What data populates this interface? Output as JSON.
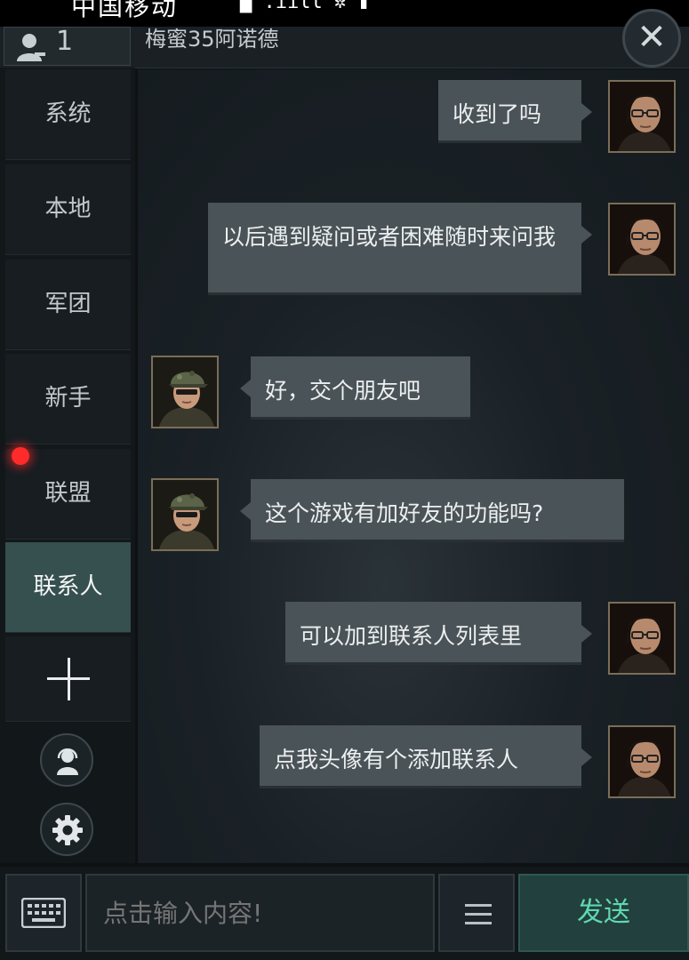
{
  "status_bar": {
    "carrier": "中国移动",
    "signal_text": "▆ .ııll ✲ ▮"
  },
  "header": {
    "online_count": "1",
    "chat_title": "梅蜜35阿诺德",
    "close_icon": "close-icon"
  },
  "sidebar": {
    "tabs": [
      {
        "label": "系统",
        "active": false
      },
      {
        "label": "本地",
        "active": false
      },
      {
        "label": "军团",
        "active": false
      },
      {
        "label": "新手",
        "active": false
      },
      {
        "label": "联盟",
        "active": false,
        "notification": true
      },
      {
        "label": "联系人",
        "active": true
      }
    ],
    "add_icon": "plus-icon",
    "voice_icon": "headset-icon",
    "settings_icon": "gear-icon"
  },
  "messages": [
    {
      "side": "right",
      "text": "收到了吗"
    },
    {
      "side": "right",
      "text": "以后遇到疑问或者困难随时来问我"
    },
    {
      "side": "left",
      "text": "好，交个朋友吧"
    },
    {
      "side": "left",
      "text": "这个游戏有加好友的功能吗?"
    },
    {
      "side": "right",
      "text": "可以加到联系人列表里"
    },
    {
      "side": "right",
      "text": "点我头像有个添加联系人"
    }
  ],
  "input": {
    "placeholder": "点击输入内容!",
    "keyboard_icon": "keyboard-icon",
    "menu_icon": "menu-icon"
  },
  "send_label": "发送",
  "colors": {
    "accent": "#36504f",
    "send_text": "#5fd8b0",
    "bubble": "#4a5357",
    "notification": "#ff2a2a"
  }
}
